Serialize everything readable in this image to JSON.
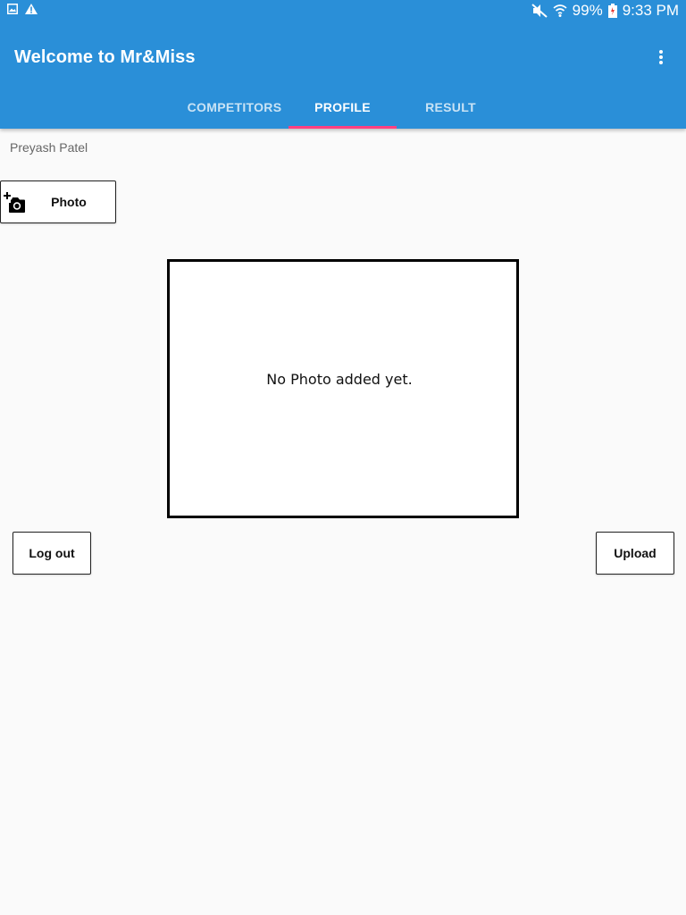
{
  "status_bar": {
    "left_icons": [
      "gallery-notification-icon",
      "warning-icon"
    ],
    "right_icons": [
      "mute-icon",
      "wifi-icon",
      "battery-icon"
    ],
    "battery": "99%",
    "time": "9:33 PM"
  },
  "app_bar": {
    "title": "Welcome to Mr&Miss",
    "menu_icon": "more-vert-icon",
    "color": "#2a8fd8"
  },
  "tabs": [
    {
      "label": "COMPETITORS",
      "active": false
    },
    {
      "label": "PROFILE",
      "active": true
    },
    {
      "label": "RESULT",
      "active": false
    }
  ],
  "tab_indicator_color": "#ff4081",
  "profile": {
    "user_name": "Preyash Patel",
    "photo_button_label": "Photo",
    "photo_button_icon": "add-a-photo-icon",
    "no_photo_message": "No Photo added yet.",
    "logout_label": "Log out",
    "upload_label": "Upload"
  }
}
